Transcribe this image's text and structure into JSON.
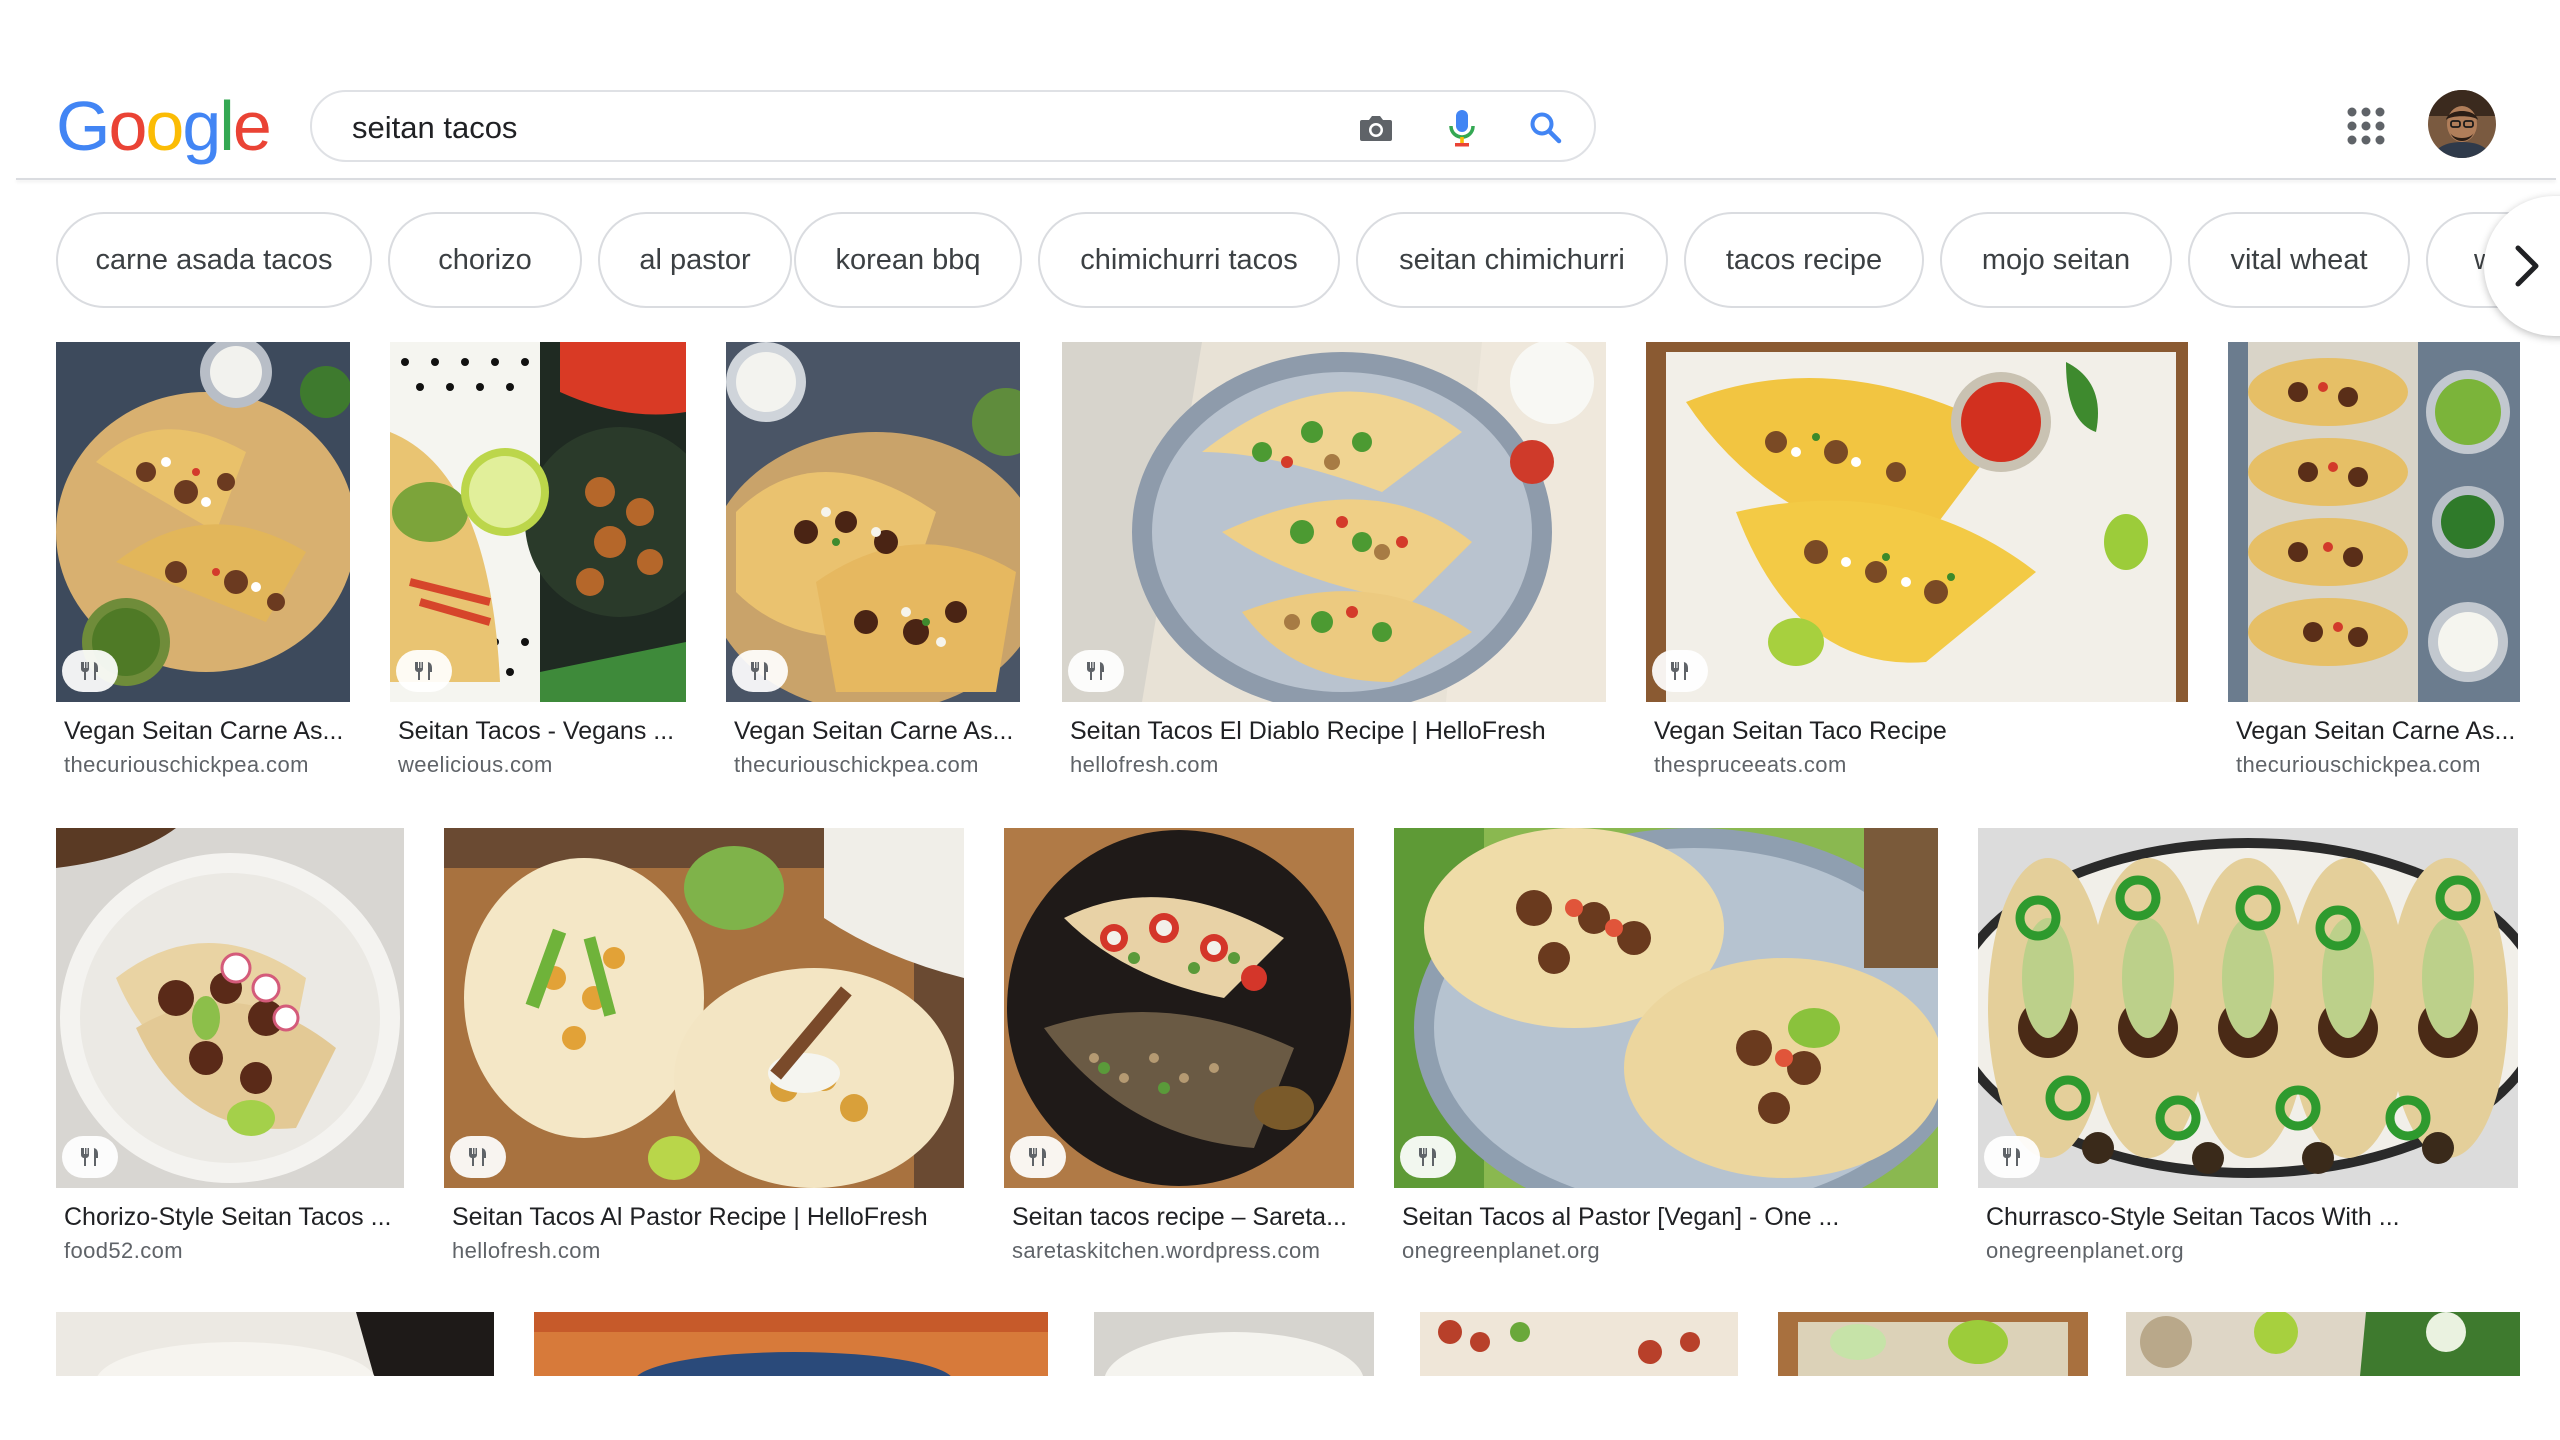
{
  "logo": {
    "text": "Google",
    "letters": [
      "G",
      "o",
      "o",
      "g",
      "l",
      "e"
    ],
    "colors": [
      "#4285f4",
      "#ea4335",
      "#fbbc05",
      "#4285f4",
      "#34a853",
      "#ea4335"
    ]
  },
  "search": {
    "query": "seitan tacos",
    "camera_icon": "camera-icon",
    "mic_icon": "mic-icon",
    "search_icon": "search-icon"
  },
  "header": {
    "apps_icon": "apps-grid-icon",
    "avatar_icon": "user-avatar"
  },
  "chips": [
    "carne asada tacos",
    "chorizo",
    "al pastor",
    "korean bbq",
    "chimichurri tacos",
    "seitan chimichurri",
    "tacos recipe",
    "mojo seitan",
    "vital wheat",
    "w"
  ],
  "chip_next_icon": "chevron-right-icon",
  "results_row1": [
    {
      "title": "Vegan Seitan Carne As...",
      "site": "thecuriouschickpea.com",
      "badge_icon": "recipe-icon"
    },
    {
      "title": "Seitan Tacos - Vegans ...",
      "site": "weelicious.com",
      "badge_icon": "recipe-icon"
    },
    {
      "title": "Vegan Seitan Carne As...",
      "site": "thecuriouschickpea.com",
      "badge_icon": "recipe-icon"
    },
    {
      "title": "Seitan Tacos El Diablo Recipe | HelloFresh",
      "site": "hellofresh.com",
      "badge_icon": "recipe-icon"
    },
    {
      "title": "Vegan Seitan Taco Recipe",
      "site": "thespruceeats.com",
      "badge_icon": "recipe-icon"
    },
    {
      "title": "Vegan Seitan Carne As...",
      "site": "thecuriouschickpea.com",
      "badge_icon": "recipe-icon"
    }
  ],
  "results_row2": [
    {
      "title": "Chorizo-Style Seitan Tacos ...",
      "site": "food52.com",
      "badge_icon": "recipe-icon"
    },
    {
      "title": "Seitan Tacos Al Pastor Recipe | HelloFresh",
      "site": "hellofresh.com",
      "badge_icon": "recipe-icon"
    },
    {
      "title": "Seitan tacos recipe – Sareta...",
      "site": "saretaskitchen.wordpress.com",
      "badge_icon": "recipe-icon"
    },
    {
      "title": "Seitan Tacos al Pastor [Vegan] - One ...",
      "site": "onegreenplanet.org",
      "badge_icon": "recipe-icon"
    },
    {
      "title": "Churrasco-Style Seitan Tacos With ...",
      "site": "onegreenplanet.org",
      "badge_icon": "recipe-icon"
    }
  ],
  "colors": {
    "accent_blue": "#4285f4",
    "mic_red": "#ea4335",
    "text_primary": "#202124",
    "text_secondary": "#5f6368",
    "border": "#dadce0"
  }
}
